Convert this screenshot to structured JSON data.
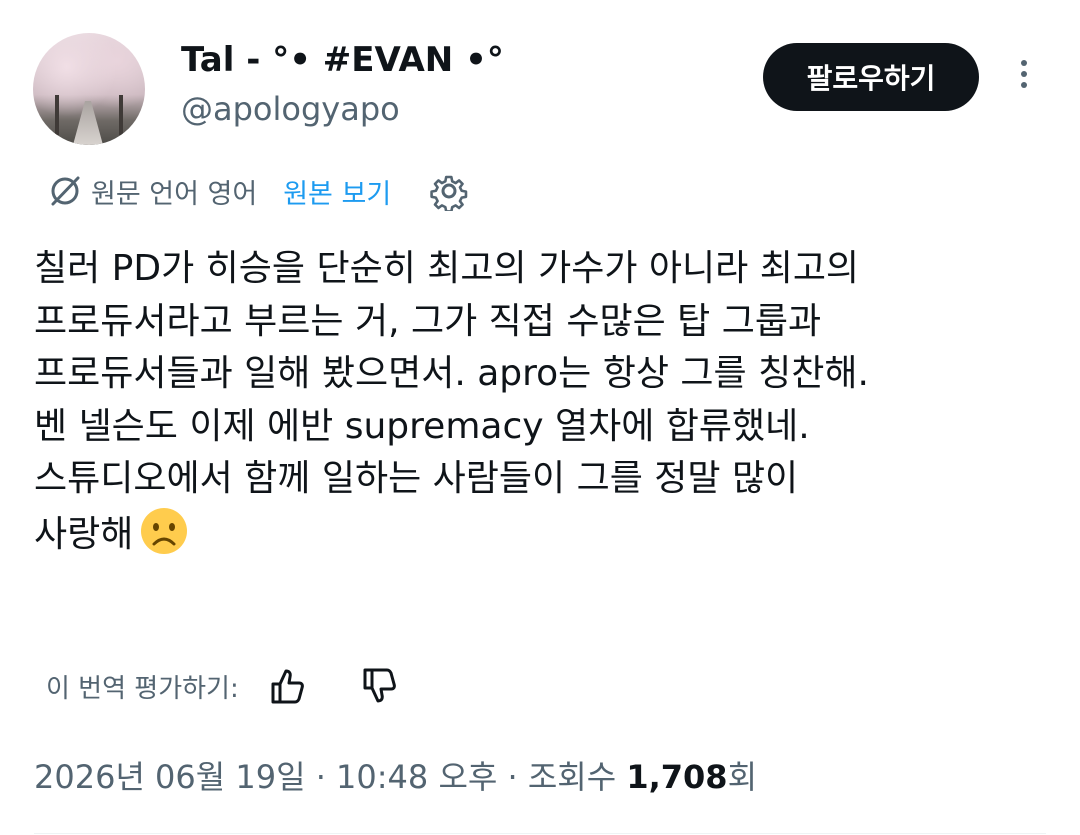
{
  "author": {
    "display_name": "Tal - °• #EVAN •°",
    "handle": "@apologyapo"
  },
  "follow_button": {
    "label": "팔로우하기"
  },
  "translation": {
    "source_language": "원문 언어 영어",
    "show_original_label": "원본 보기"
  },
  "tweet": {
    "lines": [
      "칠러 PD가 히승을 단순히 최고의 가수가 아니라 최고의",
      "프로듀서라고 부르는 거, 그가 직접 수많은 탑 그룹과",
      "프로듀서들과 일해 봤으면서. apro는 항상 그를 칭찬해.",
      "벤 넬슨도 이제 에반 supremacy 열차에 합류했네.",
      "스튜디오에서 함께 일하는 사람들이 그를 정말 많이",
      "사랑해"
    ]
  },
  "rating": {
    "label": "이 번역 평가하기:"
  },
  "meta": {
    "timestamp": "2026년 06월 19일 · 10:48 오후 · 조회수",
    "views_count": "1,708",
    "views_suffix": "회"
  },
  "colors": {
    "accent": "#1d9bf0",
    "text": "#0f1419",
    "secondary": "#536471"
  }
}
